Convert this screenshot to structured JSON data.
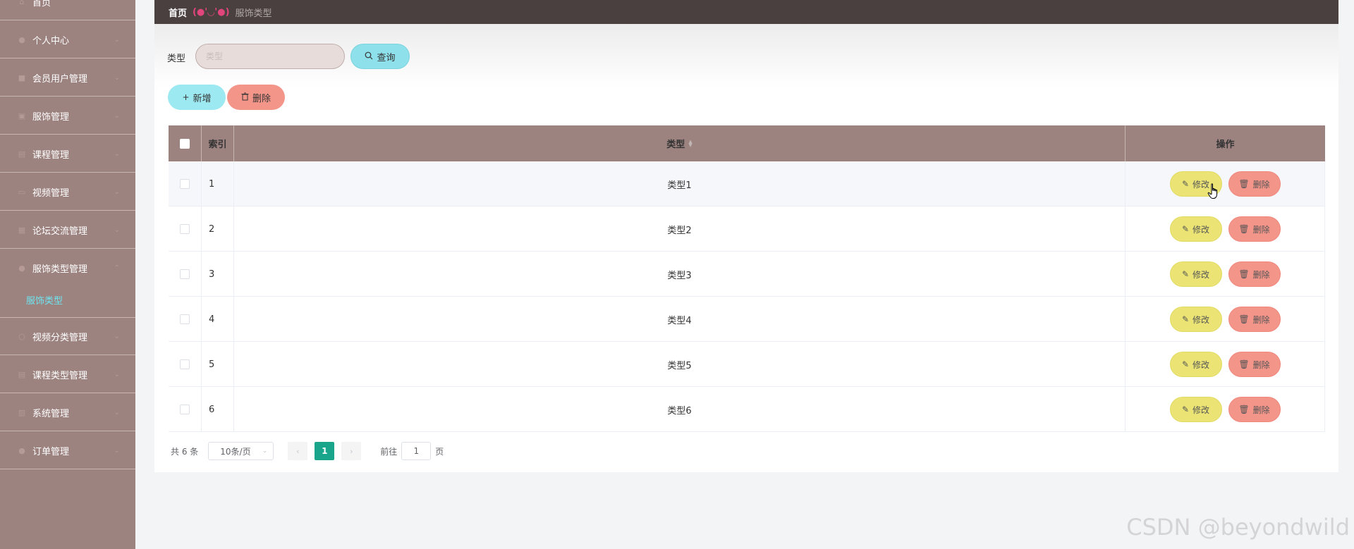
{
  "sidebar": {
    "items": [
      {
        "label": "首页",
        "icon": "home-icon",
        "has_arrow": false
      },
      {
        "label": "个人中心",
        "icon": "user-icon",
        "has_arrow": true
      },
      {
        "label": "会员用户管理",
        "icon": "users-icon",
        "has_arrow": true
      },
      {
        "label": "服饰管理",
        "icon": "shirt-icon",
        "has_arrow": true
      },
      {
        "label": "课程管理",
        "icon": "book-icon",
        "has_arrow": true
      },
      {
        "label": "视频管理",
        "icon": "video-icon",
        "has_arrow": true
      },
      {
        "label": "论坛交流管理",
        "icon": "chat-icon",
        "has_arrow": true
      },
      {
        "label": "服饰类型管理",
        "icon": "tag-icon",
        "has_arrow": true
      },
      {
        "label": "视频分类管理",
        "icon": "folder-icon",
        "has_arrow": true
      },
      {
        "label": "课程类型管理",
        "icon": "list-icon",
        "has_arrow": true
      },
      {
        "label": "系统管理",
        "icon": "gear-icon",
        "has_arrow": true
      },
      {
        "label": "订单管理",
        "icon": "order-icon",
        "has_arrow": true
      }
    ],
    "submenu_active": "服饰类型"
  },
  "breadcrumb": {
    "home": "首页",
    "emoji": "(●'◡'●)",
    "current": "服饰类型"
  },
  "search": {
    "label": "类型",
    "placeholder": "类型",
    "value": "",
    "query_button": "查询"
  },
  "actions": {
    "add_button": "新增",
    "delete_button": "删除"
  },
  "table": {
    "columns": [
      "索引",
      "类型",
      "操作"
    ],
    "rows": [
      {
        "index": "1",
        "type": "类型1"
      },
      {
        "index": "2",
        "type": "类型2"
      },
      {
        "index": "3",
        "type": "类型3"
      },
      {
        "index": "4",
        "type": "类型4"
      },
      {
        "index": "5",
        "type": "类型5"
      },
      {
        "index": "6",
        "type": "类型6"
      }
    ],
    "edit_label": "修改",
    "delete_label": "删除"
  },
  "pagination": {
    "total": "共 6 条",
    "page_size": "10条/页",
    "current_page": "1",
    "goto_label": "前往",
    "goto_value": "1",
    "page_suffix": "页"
  },
  "watermark": "CSDN @beyondwild",
  "colors": {
    "sidebar_bg": "#9c8380",
    "topbar_bg": "#4a4040",
    "active_submenu": "#6ee4ef",
    "edit_button": "#ebe475",
    "delete_button": "#f4958a",
    "add_button": "#9de9f1",
    "pagination_active": "#18a58c"
  }
}
